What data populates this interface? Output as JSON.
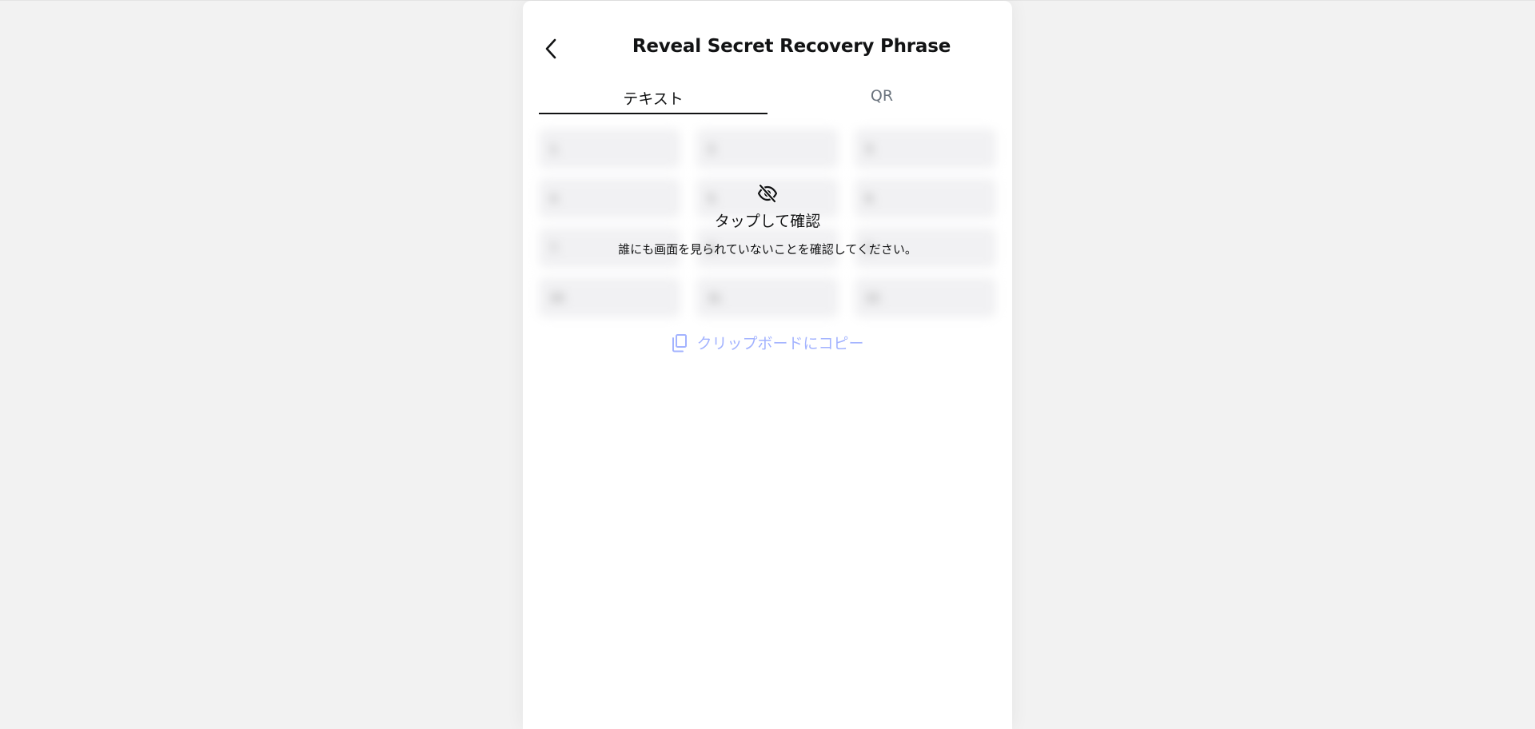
{
  "header": {
    "title": "Reveal Secret Recovery Phrase",
    "back_icon": "chevron-left-icon"
  },
  "tabs": [
    {
      "label": "テキスト",
      "active": true
    },
    {
      "label": "QR",
      "active": false
    }
  ],
  "reveal_overlay": {
    "icon": "eye-off-icon",
    "title": "タップして確認",
    "subtitle": "誰にも画面を見られていないことを確認してください。"
  },
  "words": [
    {
      "num": "1.",
      "word": ""
    },
    {
      "num": "2.",
      "word": ""
    },
    {
      "num": "3.",
      "word": ""
    },
    {
      "num": "4.",
      "word": ""
    },
    {
      "num": "5.",
      "word": ""
    },
    {
      "num": "6.",
      "word": ""
    },
    {
      "num": "7.",
      "word": ""
    },
    {
      "num": "8.",
      "word": ""
    },
    {
      "num": "9.",
      "word": ""
    },
    {
      "num": "10.",
      "word": ""
    },
    {
      "num": "11.",
      "word": ""
    },
    {
      "num": "12.",
      "word": ""
    }
  ],
  "copy": {
    "label": "クリップボードにコピー",
    "icon": "copy-icon",
    "disabled": true
  },
  "colors": {
    "background": "#f2f2f2",
    "panel": "#ffffff",
    "text_primary": "#121314",
    "text_muted": "#6a737d",
    "accent_disabled": "#a3b3ff",
    "word_cell": "#f1f1f3"
  }
}
